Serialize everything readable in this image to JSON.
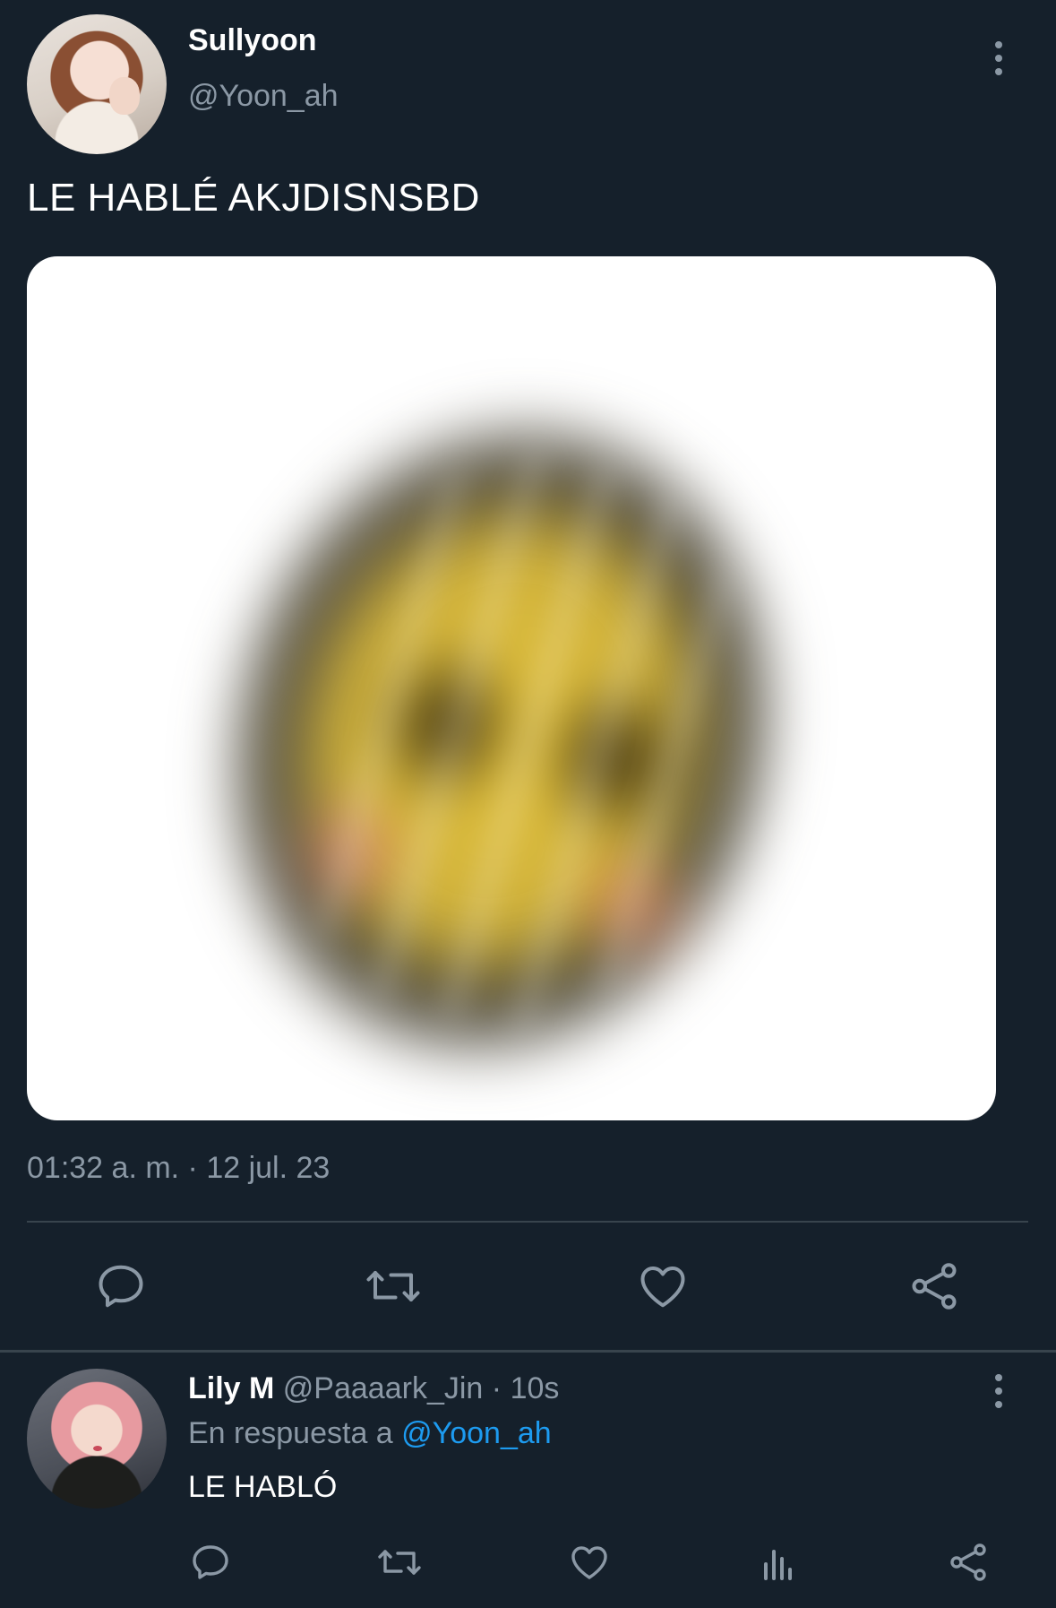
{
  "main_tweet": {
    "display_name": "Sullyoon",
    "handle": "@Yoon_ah",
    "text": "LE HABLÉ AKJDISNSBD",
    "timestamp": "01:32 a. m. · 12 jul. 23",
    "actions": [
      "reply-icon",
      "retweet-icon",
      "like-icon",
      "share-icon"
    ]
  },
  "reply_tweet": {
    "display_name": "Lily M",
    "handle": "@Paaaark_Jin",
    "separator": "·",
    "time": "10s",
    "reply_prefix": "En respuesta a",
    "reply_mention": "@Yoon_ah",
    "text": "LE HABLÓ",
    "actions": [
      "reply-icon",
      "retweet-icon",
      "like-icon",
      "views-icon",
      "share-icon"
    ]
  },
  "colors": {
    "background": "#15202b",
    "secondary_text": "#8b98a5",
    "divider": "#38444d",
    "link": "#1d9bf0"
  }
}
